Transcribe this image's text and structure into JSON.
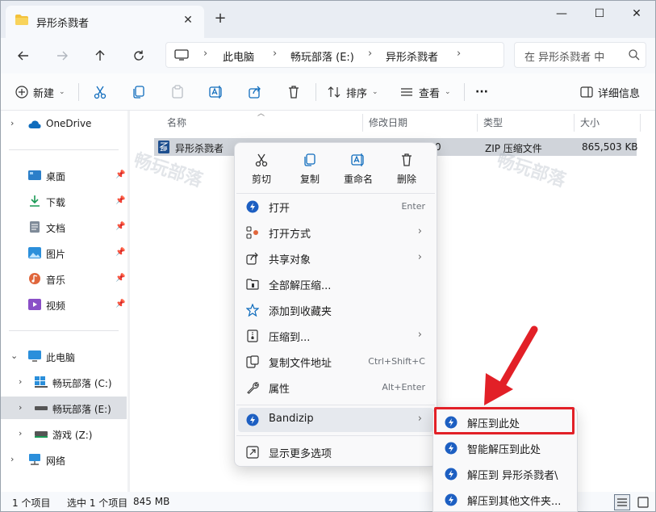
{
  "titlebar": {
    "tab_title": "异形杀戮者",
    "close_tab": "✕",
    "new_tab": "+",
    "minimize": "—",
    "maximize": "☐",
    "close": "✕"
  },
  "navbar": {
    "breadcrumb": [
      "此电脑",
      "畅玩部落 (E:)",
      "异形杀戮者"
    ],
    "search_placeholder": "在 异形杀戮者 中"
  },
  "commandbar": {
    "new": "新建",
    "sort": "排序",
    "view": "查看",
    "more": "···",
    "details": "详细信息"
  },
  "sidebar": {
    "onedrive": "OneDrive",
    "quick": [
      {
        "label": "桌面",
        "icon": "desktop-icon"
      },
      {
        "label": "下载",
        "icon": "download-icon"
      },
      {
        "label": "文档",
        "icon": "document-icon"
      },
      {
        "label": "图片",
        "icon": "pictures-icon"
      },
      {
        "label": "音乐",
        "icon": "music-icon"
      },
      {
        "label": "视频",
        "icon": "video-icon"
      }
    ],
    "this_pc": "此电脑",
    "drives": [
      {
        "label": "畅玩部落 (C:)"
      },
      {
        "label": "畅玩部落 (E:)"
      },
      {
        "label": "游戏 (Z:)"
      }
    ],
    "network": "网络"
  },
  "filelist": {
    "columns": {
      "name": "名称",
      "modified": "修改日期",
      "type": "类型",
      "size": "大小"
    },
    "rows": [
      {
        "name": "异形杀戮者",
        "modified_tail": "0",
        "type": "ZIP 压缩文件",
        "size": "865,503 KB"
      }
    ],
    "watermark": "畅玩部落"
  },
  "statusbar": {
    "count": "1 个项目",
    "selected": "选中 1 个项目",
    "size": "845 MB"
  },
  "context_menu": {
    "quick_actions": [
      "剪切",
      "复制",
      "重命名",
      "删除"
    ],
    "items": [
      {
        "label": "打开",
        "key": "Enter"
      },
      {
        "label": "打开方式",
        "key": "›"
      },
      {
        "label": "共享对象",
        "key": "›"
      },
      {
        "label": "全部解压缩...",
        "key": ""
      },
      {
        "label": "添加到收藏夹",
        "key": ""
      },
      {
        "label": "压缩到...",
        "key": "›"
      },
      {
        "label": "复制文件地址",
        "key": "Ctrl+Shift+C"
      },
      {
        "label": "属性",
        "key": "Alt+Enter"
      }
    ],
    "bandizip": "Bandizip",
    "more_options": "显示更多选项"
  },
  "submenu": {
    "items": [
      "解压到此处",
      "智能解压到此处",
      "解压到 异形杀戮者\\",
      "解压到其他文件夹..."
    ]
  },
  "colors": {
    "accent": "#0f6cbd",
    "highlight": "#e22027",
    "selection": "#d0d4da"
  }
}
